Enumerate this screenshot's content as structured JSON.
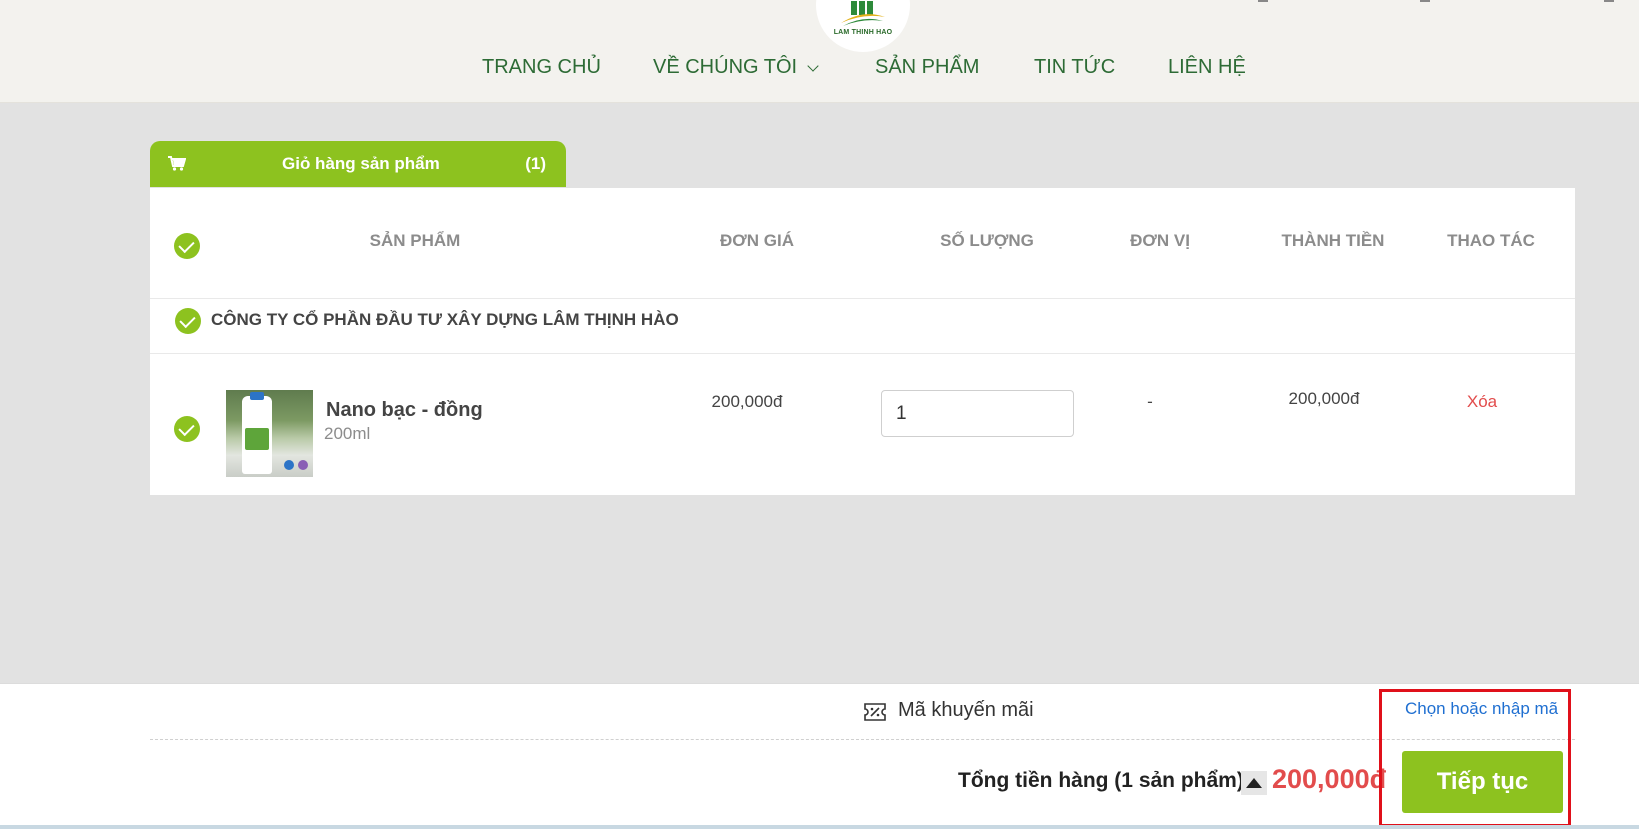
{
  "header": {
    "logo_text": "LAM THINH HAO",
    "nav": [
      {
        "label": "TRANG CHỦ"
      },
      {
        "label": "VỀ CHÚNG TÔI",
        "has_dropdown": true
      },
      {
        "label": "SẢN PHẨM"
      },
      {
        "label": "TIN TỨC"
      },
      {
        "label": "LIÊN HỆ"
      }
    ]
  },
  "cart_tab": {
    "label": "Giỏ hàng sản phẩm",
    "count": "(1)",
    "icon": "cart-icon"
  },
  "table": {
    "columns": [
      "SẢN PHẨM",
      "ĐƠN GIÁ",
      "SỐ LƯỢNG",
      "ĐƠN VỊ",
      "THÀNH TIỀN",
      "THAO TÁC"
    ]
  },
  "shop": {
    "name": "CÔNG TY CỔ PHẦN ĐẦU TƯ XÂY DỰNG LÂM THỊNH HÀO"
  },
  "items": [
    {
      "name": "Nano bạc - đồng",
      "variant": "200ml",
      "unit_price": "200,000đ",
      "quantity": "1",
      "unit": "-",
      "subtotal": "200,000đ",
      "action": "Xóa"
    }
  ],
  "footer": {
    "promo_label": "Mã khuyến mãi",
    "promo_link": "Chọn hoặc nhập mã",
    "total_label": "Tổng tiền hàng (1 sản phẩm)",
    "total_amount": "200,000đ",
    "continue_label": "Tiếp tục"
  },
  "colors": {
    "accent_green": "#8dc21f",
    "nav_green": "#2d6b35",
    "price_red": "#e24c4c",
    "link_blue": "#1f6fd1",
    "highlight_red": "#e0101a"
  }
}
